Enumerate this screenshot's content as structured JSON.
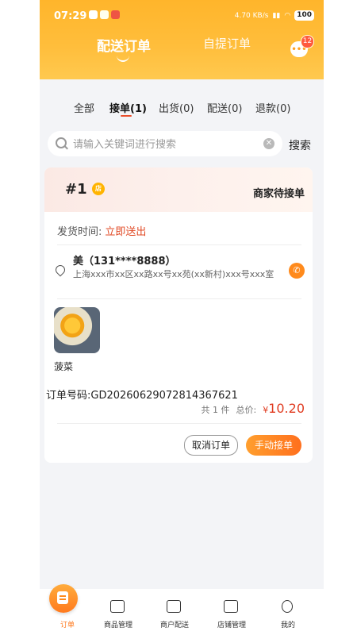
{
  "status_bar": {
    "time": "07:29",
    "network": "4.70 KB/s",
    "battery": "100"
  },
  "top_tabs": {
    "active": "配送订单",
    "other": "自提订单"
  },
  "message": {
    "badge": "12"
  },
  "filter_tabs": [
    {
      "label": "全部"
    },
    {
      "label": "接单(1)"
    },
    {
      "label": "出货(0)"
    },
    {
      "label": "配送(0)"
    },
    {
      "label": "退款(0)"
    }
  ],
  "search": {
    "placeholder": "请输入关键词进行搜索",
    "button": "搜索"
  },
  "order": {
    "index": "#1",
    "status": "商家待接单",
    "ship_label": "发货时间:",
    "ship_value": "立即送出",
    "customer": "美（131****8888）",
    "address": "上海xxx市xx区xx路xx号xx苑(xx新村)xxx号xxx室",
    "product_name": "菠菜",
    "order_no": "订单号码:GD20260629072814367621",
    "count": "共 1 件",
    "total_label": "总价:",
    "currency": "¥",
    "price": "10.20",
    "cancel_button": "取消订单",
    "accept_button": "手动接单"
  },
  "bottom_nav": [
    {
      "label": "订单"
    },
    {
      "label": "商品管理"
    },
    {
      "label": "商户配送"
    },
    {
      "label": "店铺管理"
    },
    {
      "label": "我的"
    }
  ]
}
